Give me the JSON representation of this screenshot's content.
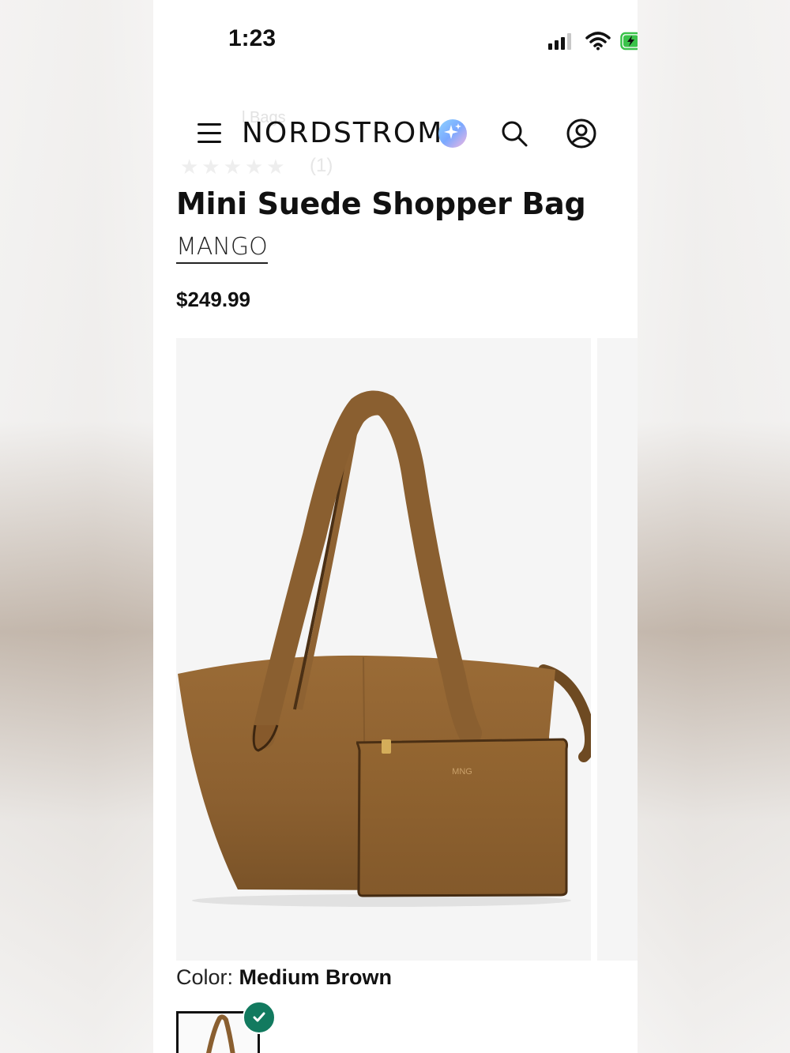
{
  "status_bar": {
    "time": "1:23",
    "icons": [
      "cellular-signal-icon",
      "wifi-icon",
      "battery-charging-icon"
    ]
  },
  "header": {
    "breadcrumb_ghost": "l Bags",
    "rating_count_ghost": "(1)",
    "logo": "NORDSTROM",
    "icons": [
      "menu-icon",
      "ai-sparkle-icon",
      "search-icon",
      "account-icon"
    ]
  },
  "product": {
    "title": "Mini Suede Shopper Bag",
    "brand": "MANGO",
    "price": "$249.99",
    "color_label": "Color:",
    "color_value": "Medium Brown",
    "swatch_selected": true
  },
  "colors": {
    "accent_green": "#127a5f",
    "text": "#111111",
    "suede": "#8f6432"
  }
}
